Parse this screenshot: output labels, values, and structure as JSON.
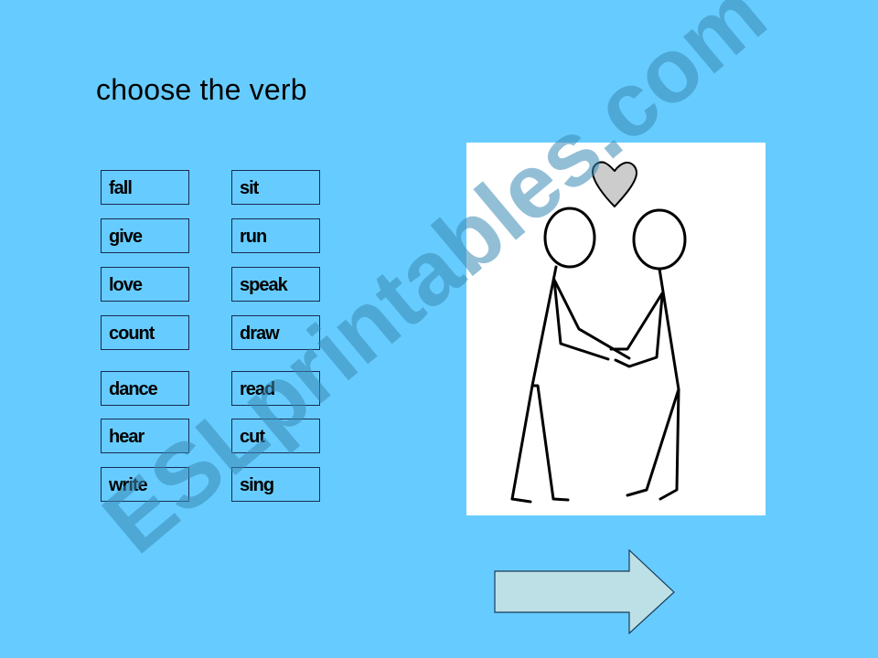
{
  "slide": {
    "title": "choose the verb",
    "background_color": "#66ccff"
  },
  "verbs": {
    "left_column": [
      "fall",
      "give",
      "love",
      "count",
      "dance",
      "hear",
      "write"
    ],
    "right_column": [
      "sit",
      "run",
      "speak",
      "draw",
      "read",
      "cut",
      "sing"
    ]
  },
  "picture": {
    "description": "two stick figures holding hands with a heart above",
    "heart_color": "#cccccc"
  },
  "navigation": {
    "next_arrow": "right-arrow",
    "arrow_fill": "#bde0e6"
  },
  "watermark": {
    "text": "ESLprintables.com"
  }
}
